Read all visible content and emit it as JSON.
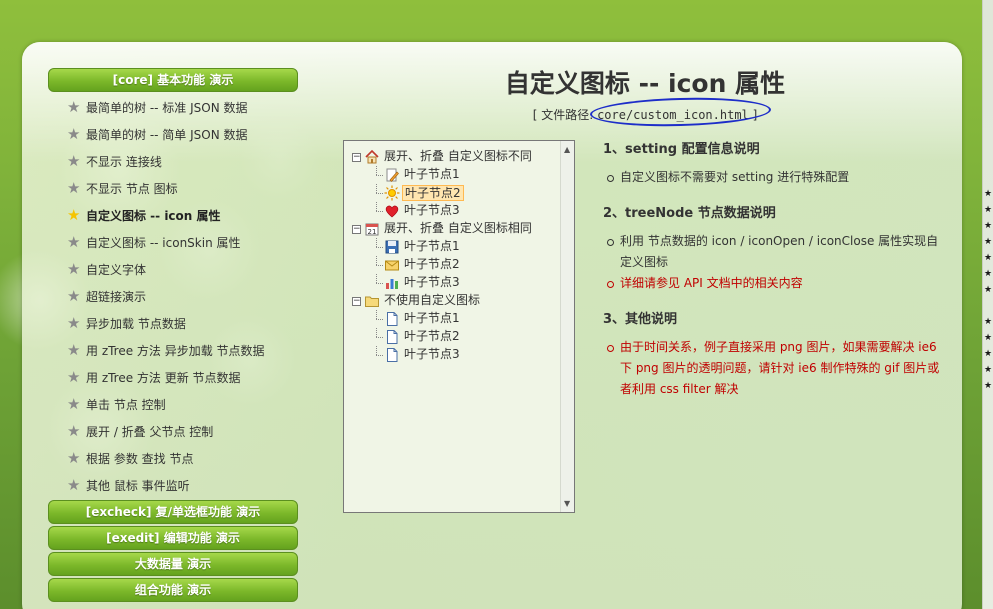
{
  "title": "自定义图标 -- icon 属性",
  "path_label": "[ 文件路径: ",
  "path_value": "core/custom_icon.html",
  "path_close": " ]",
  "menu": {
    "sections": [
      {
        "header": "[core] 基本功能 演示",
        "items": [
          "最简单的树 -- 标准 JSON 数据",
          "最简单的树 -- 简单 JSON 数据",
          "不显示 连接线",
          "不显示 节点 图标",
          "自定义图标 -- icon 属性",
          "自定义图标 -- iconSkin 属性",
          "自定义字体",
          "超链接演示",
          "异步加载 节点数据",
          "用 zTree 方法 异步加载 节点数据",
          "用 zTree 方法 更新 节点数据",
          "单击 节点 控制",
          "展开 / 折叠 父节点 控制",
          "根据 参数 查找 节点",
          "其他 鼠标 事件监听"
        ],
        "active_index": 4
      },
      {
        "header": "[excheck] 复/单选框功能 演示"
      },
      {
        "header": "[exedit] 编辑功能 演示"
      },
      {
        "header": "大数据量 演示"
      },
      {
        "header": "组合功能 演示"
      }
    ]
  },
  "tree": {
    "groups": [
      {
        "label": "展开、折叠 自定义图标不同",
        "icon": "home-icon",
        "switch": "⊟",
        "children": [
          {
            "label": "叶子节点1",
            "icon": "pencil-doc-icon"
          },
          {
            "label": "叶子节点2",
            "icon": "sun-icon",
            "selected": true
          },
          {
            "label": "叶子节点3",
            "icon": "heart-icon"
          }
        ]
      },
      {
        "label": "展开、折叠 自定义图标相同",
        "icon": "calendar-icon",
        "switch": "⊟",
        "children": [
          {
            "label": "叶子节点1",
            "icon": "floppy-icon"
          },
          {
            "label": "叶子节点2",
            "icon": "envelope-icon"
          },
          {
            "label": "叶子节点3",
            "icon": "bar-chart-icon"
          }
        ]
      },
      {
        "label": "不使用自定义图标",
        "icon": "folder-icon",
        "switch": "⊟",
        "children": [
          {
            "label": "叶子节点1",
            "icon": "page-icon"
          },
          {
            "label": "叶子节点2",
            "icon": "page-icon"
          },
          {
            "label": "叶子节点3",
            "icon": "page-icon"
          }
        ]
      }
    ]
  },
  "desc": {
    "s1_title": "1、setting 配置信息说明",
    "s1_items": [
      "自定义图标不需要对 setting 进行特殊配置"
    ],
    "s2_title": "2、treeNode 节点数据说明",
    "s2_items": [
      "利用 节点数据的 icon / iconOpen / iconClose 属性实现自定义图标"
    ],
    "s2_red": "详细请参见 API 文档中的相关内容",
    "s3_title": "3、其他说明",
    "s3_red": "由于时间关系，例子直接采用 png 图片，如果需要解决 ie6 下 png 图片的透明问题，请针对 ie6 制作特殊的 gif 图片或者利用 css filter 解决"
  },
  "colors": {
    "accent": "#7cb82a",
    "selected_bg": "#ffe6b0",
    "annotation": "#1d2dc9",
    "note_red": "#c00000"
  }
}
